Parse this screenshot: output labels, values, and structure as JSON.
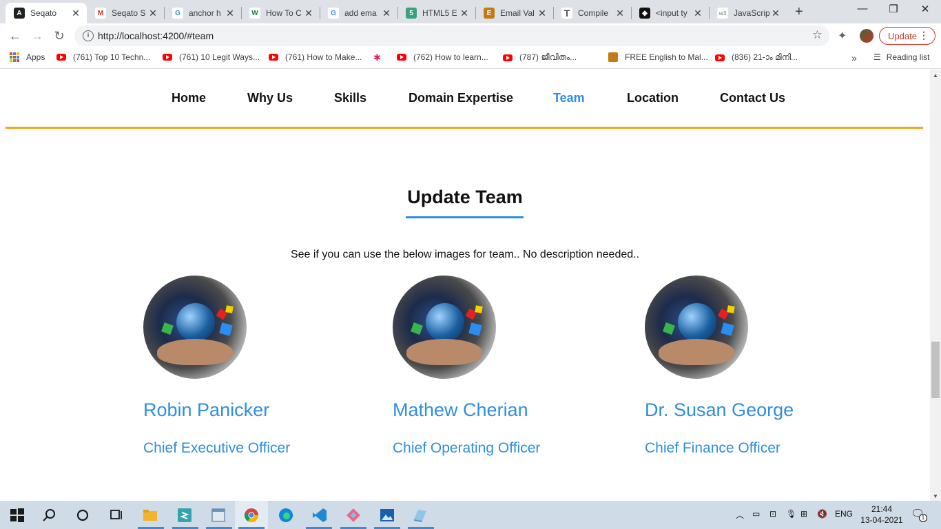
{
  "browser": {
    "tabs": [
      {
        "title": "Seqato",
        "active": true,
        "icon": "angular-icon",
        "color": "#202124"
      },
      {
        "title": "Seqato S",
        "icon": "gmail-icon",
        "color": "#d93025"
      },
      {
        "title": "anchor h",
        "icon": "google-icon",
        "color": "#4285f4"
      },
      {
        "title": "How To C",
        "icon": "wikihow-icon",
        "color": "#1d7a3a"
      },
      {
        "title": "add ema",
        "icon": "google-icon",
        "color": "#4285f4"
      },
      {
        "title": "HTML5 E",
        "icon": "html5-icon",
        "color": "#3aa17e"
      },
      {
        "title": "Email Val",
        "icon": "script-icon",
        "color": "#c47a12"
      },
      {
        "title": "Compile",
        "icon": "typo-icon",
        "color": "#555555"
      },
      {
        "title": "<input ty",
        "icon": "codepen-icon",
        "color": "#111111"
      },
      {
        "title": "JavaScrip",
        "icon": "w3schools-icon",
        "color": "#999999"
      }
    ],
    "url": "http://localhost:4200/#team",
    "update_label": "Update",
    "bookmarks": [
      {
        "label": "Apps",
        "icon": "apps-grid-icon"
      },
      {
        "label": "(761) Top 10 Techn...",
        "icon": "youtube-icon"
      },
      {
        "label": "(761) 10 Legit Ways...",
        "icon": "youtube-icon"
      },
      {
        "label": "(761) How to Make...",
        "icon": "youtube-icon"
      },
      {
        "label": "",
        "icon": "slack-icon"
      },
      {
        "label": "(762) How to learn...",
        "icon": "youtube-icon"
      },
      {
        "label": "(787) ജീവിതം...",
        "icon": "youtube-icon"
      },
      {
        "label": "FREE English to Mal...",
        "icon": "dictionary-icon"
      },
      {
        "label": "(836) 21-ാം മിനി...",
        "icon": "youtube-icon"
      }
    ],
    "more_bookmarks": "»",
    "reading_list": "Reading list"
  },
  "site": {
    "nav": [
      {
        "label": "Home",
        "active": false
      },
      {
        "label": "Why Us",
        "active": false
      },
      {
        "label": "Skills",
        "active": false
      },
      {
        "label": "Domain Expertise",
        "active": false
      },
      {
        "label": "Team",
        "active": true
      },
      {
        "label": "Location",
        "active": false
      },
      {
        "label": "Contact Us",
        "active": false
      }
    ],
    "accent_color": "#2f8de4",
    "nav_border_color": "#f5a623",
    "team": {
      "title": "Update Team",
      "description": "See if you can use the below images for team.. No description needed..",
      "members": [
        {
          "name": "Robin Panicker",
          "role": "Chief Executive Officer"
        },
        {
          "name": "Mathew Cherian",
          "role": "Chief Operating Officer"
        },
        {
          "name": "Dr. Susan George",
          "role": "Chief Finance Officer"
        }
      ]
    }
  },
  "taskbar": {
    "language": "ENG",
    "time": "21:44",
    "date": "13-04-2021",
    "notifications": "1"
  }
}
